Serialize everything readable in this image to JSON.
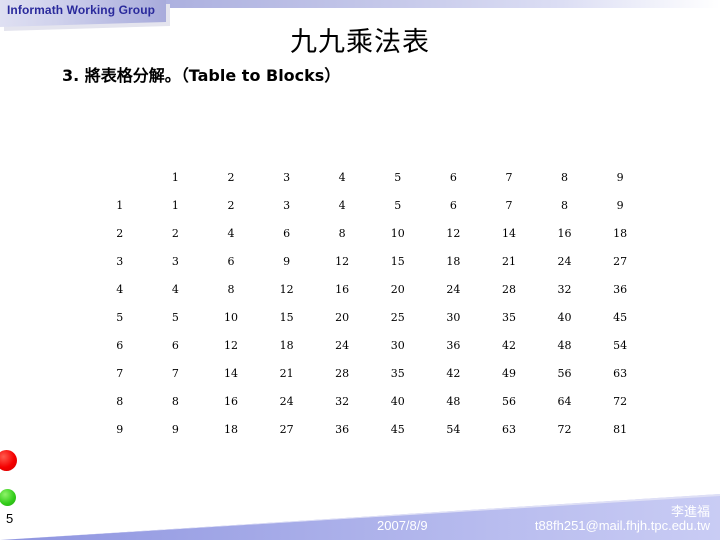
{
  "header": {
    "banner_label": "Informath Working Group"
  },
  "slide": {
    "title": "九九乘法表",
    "subtitle": "3. 將表格分解。（Table to Blocks）",
    "page_number": "5"
  },
  "table": {
    "corner": "",
    "column_headers": [
      "1",
      "2",
      "3",
      "4",
      "5",
      "6",
      "7",
      "8",
      "9"
    ],
    "rows": [
      {
        "label": "1",
        "cells": [
          "1",
          "2",
          "3",
          "4",
          "5",
          "6",
          "7",
          "8",
          "9"
        ]
      },
      {
        "label": "2",
        "cells": [
          "2",
          "4",
          "6",
          "8",
          "10",
          "12",
          "14",
          "16",
          "18"
        ]
      },
      {
        "label": "3",
        "cells": [
          "3",
          "6",
          "9",
          "12",
          "15",
          "18",
          "21",
          "24",
          "27"
        ]
      },
      {
        "label": "4",
        "cells": [
          "4",
          "8",
          "12",
          "16",
          "20",
          "24",
          "28",
          "32",
          "36"
        ]
      },
      {
        "label": "5",
        "cells": [
          "5",
          "10",
          "15",
          "20",
          "25",
          "30",
          "35",
          "40",
          "45"
        ]
      },
      {
        "label": "6",
        "cells": [
          "6",
          "12",
          "18",
          "24",
          "30",
          "36",
          "42",
          "48",
          "54"
        ]
      },
      {
        "label": "7",
        "cells": [
          "7",
          "14",
          "21",
          "28",
          "35",
          "42",
          "49",
          "56",
          "63"
        ]
      },
      {
        "label": "8",
        "cells": [
          "8",
          "16",
          "24",
          "32",
          "40",
          "48",
          "56",
          "64",
          "72"
        ]
      },
      {
        "label": "9",
        "cells": [
          "9",
          "18",
          "27",
          "36",
          "45",
          "54",
          "63",
          "72",
          "81"
        ]
      }
    ]
  },
  "footer": {
    "date": "2007/8/9",
    "email": "t88fh251@mail.fhjh.tpc.edu.tw",
    "author": "李進福"
  },
  "decorations": {
    "red_dot": "red-bullet-dot",
    "green_dot": "green-bullet-dot"
  },
  "colors": {
    "banner_text": "#2a2a9c",
    "banner_gradient_start": "#dfe0f2",
    "banner_gradient_end": "#a8abdb",
    "footer_gradient_start": "#8f95e0",
    "footer_gradient_end": "#c9ccf4",
    "red_dot": "#f40000",
    "green_dot": "#32cc19",
    "text": "#000000",
    "footer_text": "#ffffff"
  }
}
